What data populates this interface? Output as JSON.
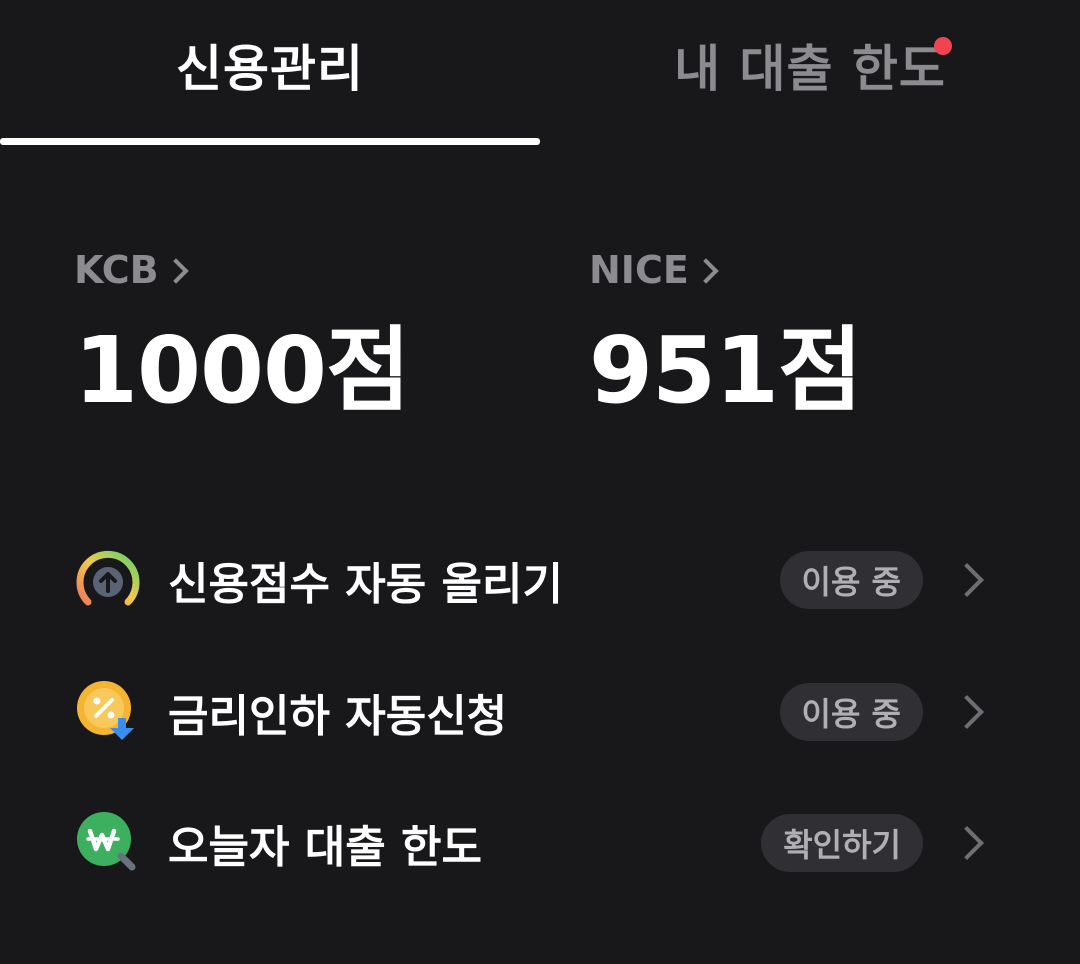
{
  "tabs": [
    {
      "label": "신용관리",
      "active": true
    },
    {
      "label": "내 대출 한도",
      "active": false,
      "has_notification": true
    }
  ],
  "scores": [
    {
      "bureau": "KCB",
      "value": "1000점"
    },
    {
      "bureau": "NICE",
      "value": "951점"
    }
  ],
  "menu": [
    {
      "label": "신용점수 자동 올리기",
      "status": "이용 중",
      "icon": "gauge-arrow-up-icon"
    },
    {
      "label": "금리인하 자동신청",
      "status": "이용 중",
      "icon": "percent-coin-download-icon"
    },
    {
      "label": "오늘자 대출 한도",
      "status": "확인하기",
      "icon": "won-search-icon"
    }
  ],
  "colors": {
    "background": "#18181b",
    "notification": "#f04452",
    "pill_background": "#2f2f34",
    "inactive_text": "#8c8c90"
  }
}
